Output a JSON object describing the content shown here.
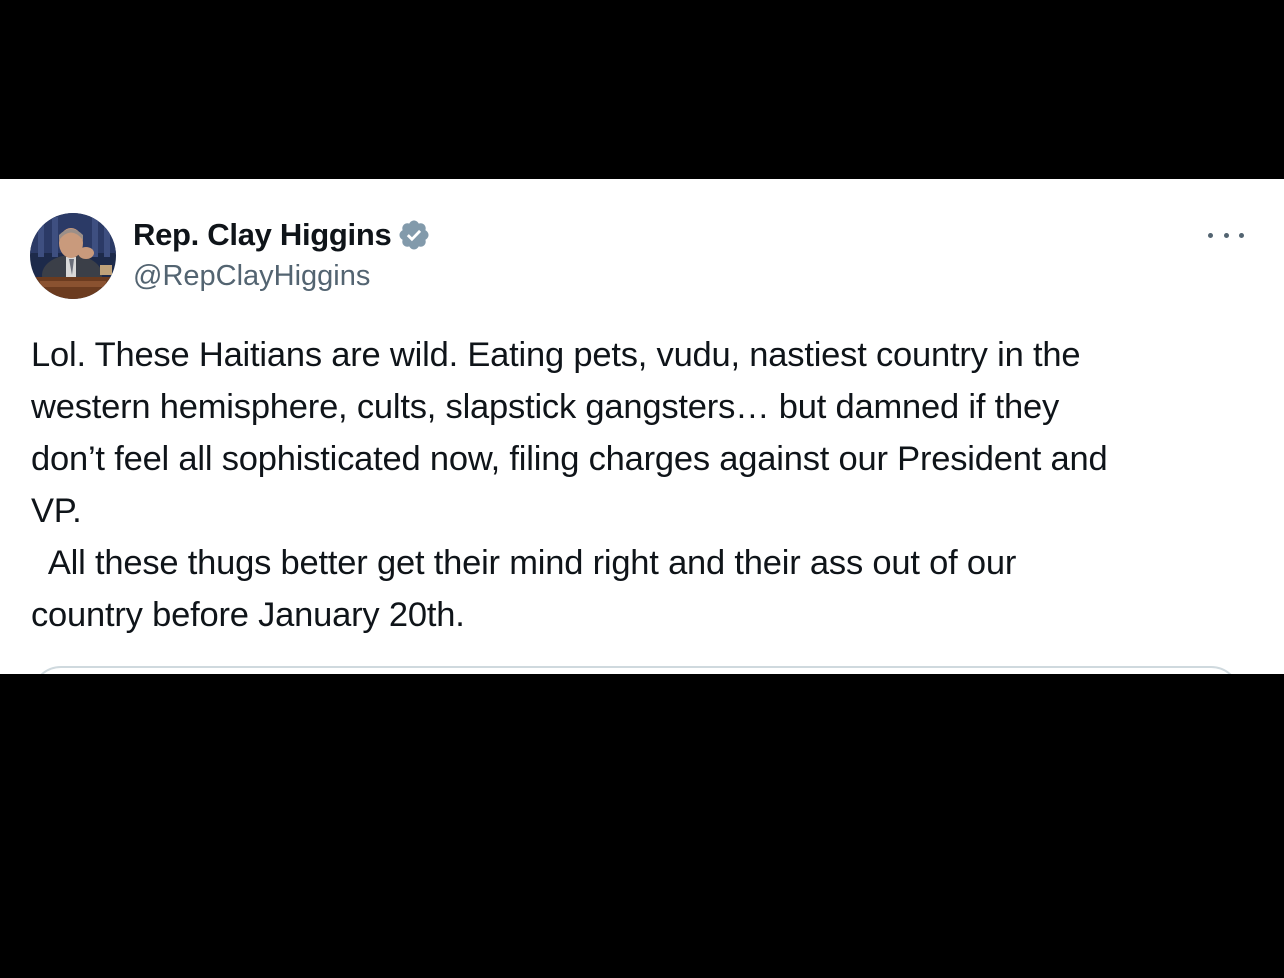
{
  "tweet": {
    "author": {
      "display_name": "Rep. Clay Higgins",
      "handle": "@RepClayHiggins",
      "verified": true,
      "verified_icon": "verified-badge-icon",
      "verified_color": "#829aab"
    },
    "more_icon": "more-options-icon",
    "text_lines": [
      "Lol. These Haitians are wild. Eating pets, vudu, nastiest country in the",
      "western hemisphere, cults, slapstick gangsters… but damned if they",
      "don’t feel all sophisticated now, filing charges against our President and",
      "VP.",
      "  All these thugs better get their mind right and their ass out of our",
      "country before January 20th."
    ]
  },
  "colors": {
    "background_outer": "#000000",
    "card_background": "#ffffff",
    "text_primary": "#0f1419",
    "text_secondary": "#536471",
    "border": "#cfd9de"
  }
}
